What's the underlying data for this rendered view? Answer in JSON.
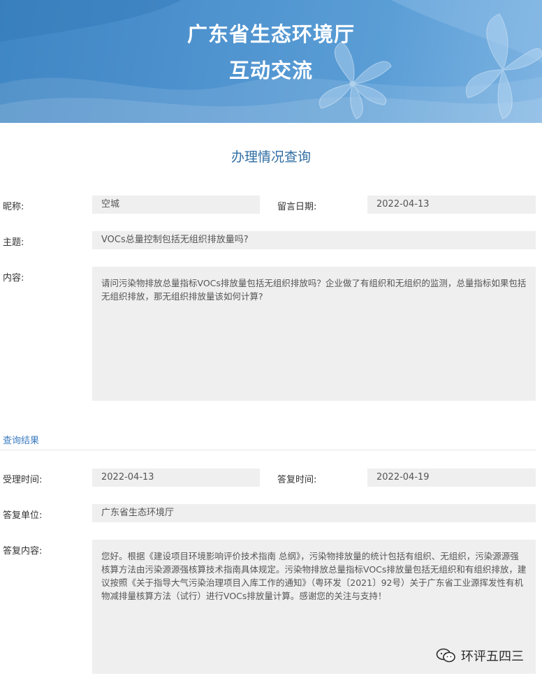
{
  "header": {
    "title_line1": "广东省生态环境厅",
    "title_line2": "互动交流",
    "background_color": "#4f93cf"
  },
  "page_title": "办理情况查询",
  "message": {
    "nickname_label": "昵称:",
    "nickname_value": "空城",
    "date_label": "留言日期:",
    "date_value": "2022-04-13",
    "subject_label": "主题:",
    "subject_value": "VOCs总量控制包括无组织排放量吗?",
    "content_label": "内容:",
    "content_value": "请问污染物排放总量指标VOCs排放量包括无组织排放吗？企业做了有组织和无组织的监测，总量指标如果包括无组织排放，那无组织排放量该如何计算?"
  },
  "result": {
    "section_label": "查询结果",
    "accept_time_label": "受理时间:",
    "accept_time_value": "2022-04-13",
    "reply_time_label": "答复时间:",
    "reply_time_value": "2022-04-19",
    "reply_unit_label": "答复单位:",
    "reply_unit_value": "广东省生态环境厅",
    "reply_content_label": "答复内容:",
    "reply_content_value": "您好。根据《建设项目环境影响评价技术指南 总纲》，污染物排放量的统计包括有组织、无组织，污染源源强核算方法由污染源源强核算技术指南具体规定。污染物排放总量指标VOCs排放量包括无组织和有组织排放，建议按照《关于指导大气污染治理项目入库工作的通知》（粤环发〔2021〕92号）关于广东省工业源挥发性有机物减排量核算方法（试行）进行VOCs排放量计算。感谢您的关注与支持！"
  },
  "watermark": {
    "text": "环评五四三",
    "icon": "wechat-icon"
  },
  "colors": {
    "accent": "#2f6da3",
    "link": "#3b7bbf",
    "field_bg": "#efefef"
  }
}
